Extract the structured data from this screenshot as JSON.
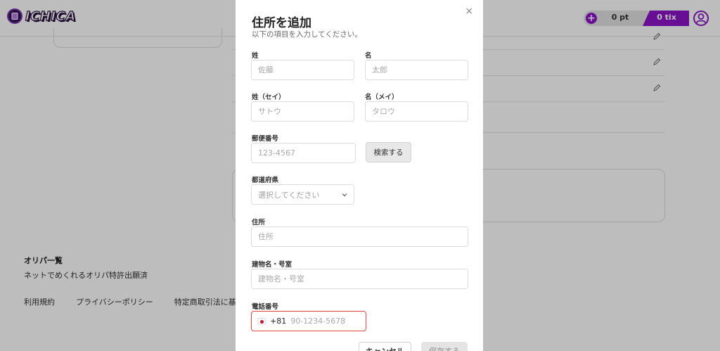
{
  "header": {
    "logo_text": "ICHICA",
    "points_label": "0 pt",
    "tix_label": "0 tix",
    "plus_symbol": "+"
  },
  "background": {
    "footer_title": "オリパ一覧",
    "footer_text": "ネットでめくれるオリパ特許出願済",
    "footer_links": [
      "利用規約",
      "プライバシーポリシー",
      "特定商取引法に基"
    ]
  },
  "modal": {
    "close_symbol": "×",
    "title": "住所を追加",
    "subtitle": "以下の項目を入力してください。",
    "last_name": {
      "label": "姓",
      "placeholder": "佐藤"
    },
    "first_name": {
      "label": "名",
      "placeholder": "太郎"
    },
    "last_name_kana": {
      "label": "姓（セイ）",
      "placeholder": "サトウ"
    },
    "first_name_kana": {
      "label": "名（メイ）",
      "placeholder": "タロウ"
    },
    "postal_code": {
      "label": "郵便番号",
      "placeholder": "123-4567",
      "search_label": "検索する"
    },
    "prefecture": {
      "label": "都道府県",
      "selected": "選択してください"
    },
    "address": {
      "label": "住所",
      "placeholder": "住所"
    },
    "building": {
      "label": "建物名・号室",
      "placeholder": "建物名・号室"
    },
    "phone": {
      "label": "電話番号",
      "dial_code": "+81",
      "placeholder": "90-1234-5678"
    },
    "cancel_label": "キャンセル",
    "save_label": "保存する"
  },
  "colors": {
    "brand_purple": "#8b14c9",
    "error_red": "#e04848"
  }
}
